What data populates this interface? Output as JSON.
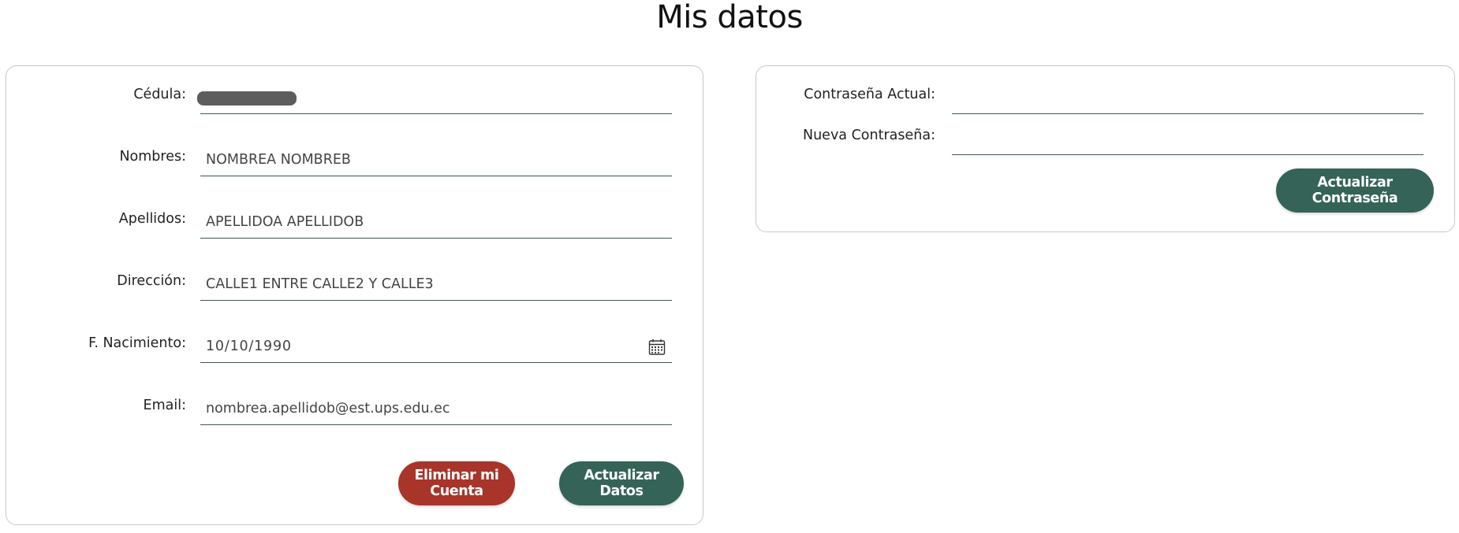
{
  "page": {
    "title": "Mis datos"
  },
  "profile": {
    "cedula": {
      "label": "Cédula:",
      "value": ""
    },
    "nombres": {
      "label": "Nombres:",
      "value": "NOMBREA NOMBREB"
    },
    "apellidos": {
      "label": "Apellidos:",
      "value": "APELLIDOA APELLIDOB"
    },
    "direccion": {
      "label": "Dirección:",
      "value": "CALLE1 ENTRE CALLE2 Y CALLE3"
    },
    "nacimiento": {
      "label": "F. Nacimiento:",
      "value": "10/10/1990"
    },
    "email": {
      "label": "Email:",
      "value": "nombrea.apellidob@est.ups.edu.ec"
    },
    "delete_label": "Eliminar mi Cuenta",
    "update_label": "Actualizar Datos"
  },
  "password": {
    "current": {
      "label": "Contraseña Actual:",
      "value": ""
    },
    "new": {
      "label": "Nueva Contraseña:",
      "value": ""
    },
    "update_label": "Actualizar Contraseña"
  },
  "colors": {
    "accent_green": "#356357",
    "danger_red": "#a8342a",
    "underline": "#3a5c55",
    "card_border": "#c8c8c8"
  },
  "icons": {
    "date_picker": "calendar-icon"
  }
}
